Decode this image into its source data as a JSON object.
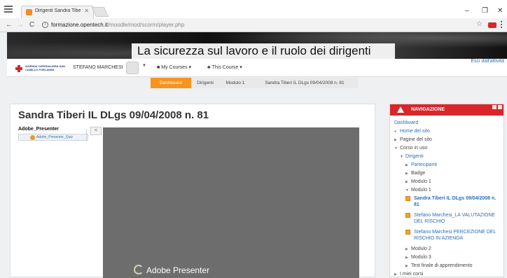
{
  "browser": {
    "tab_title": "Dirigenti Sandra Tibe",
    "tab_close": "✕",
    "url_host": "formazione.opentech.it",
    "url_path": "/moodle/mod/scorm/player.php",
    "win_minimize": "–",
    "win_maximize": "❐",
    "win_close": "✕"
  },
  "banner": {
    "title": "La sicurezza sul lavoro e il ruolo dei dirigenti"
  },
  "header": {
    "logo_text": "AZIENDA OSPEDALIERA SAN CAMILLO FORLANINI",
    "username": "STEFANO MARCHESI",
    "my_courses": "My Courses",
    "this_course": "This Course",
    "exit_activity": "Esci dall'attività"
  },
  "breadcrumb": [
    "Dashboard",
    "Dirigenti",
    "Modulo 1",
    "Sandra Tiberi IL DLgs 09/04/2008 n. 81"
  ],
  "main": {
    "title": "Sandra Tiberi IL DLgs 09/04/2008 n. 81",
    "toc_heading": "Adobe_Presenter",
    "toc_item": "Adobe_Presenter_Quiz",
    "collapse_label": "<",
    "player_label": "Adobe Presenter"
  },
  "navigation": {
    "title": "NAVIGAZIONE",
    "items": [
      {
        "label": "Dashboard"
      },
      {
        "label": "Home del sito"
      },
      {
        "label": "Pagine del sito"
      },
      {
        "label": "Corso in uso"
      },
      {
        "label": "Dirigenti"
      },
      {
        "label": "Partecipanti"
      },
      {
        "label": "Badge"
      },
      {
        "label": "Modulo 1"
      },
      {
        "label": "Modulo 1"
      },
      {
        "label": "Sandra Tiberi IL DLgs 09/04/2008 n. 81"
      },
      {
        "label": "Stefano Marchesi_LA VALUTAZIONE DEL RISCHIO"
      },
      {
        "label": "Stefano Marchesi PERCEZIONE DEL RISCHIO IN AZIENDA"
      },
      {
        "label": "Modulo 2"
      },
      {
        "label": "Modulo 3"
      },
      {
        "label": "Test finale di apprendimento"
      },
      {
        "label": "I miei corsi"
      }
    ]
  },
  "colors": {
    "accent_orange": "#f7941d",
    "nav_red": "#d9262b",
    "link_blue": "#2a6ebb"
  }
}
